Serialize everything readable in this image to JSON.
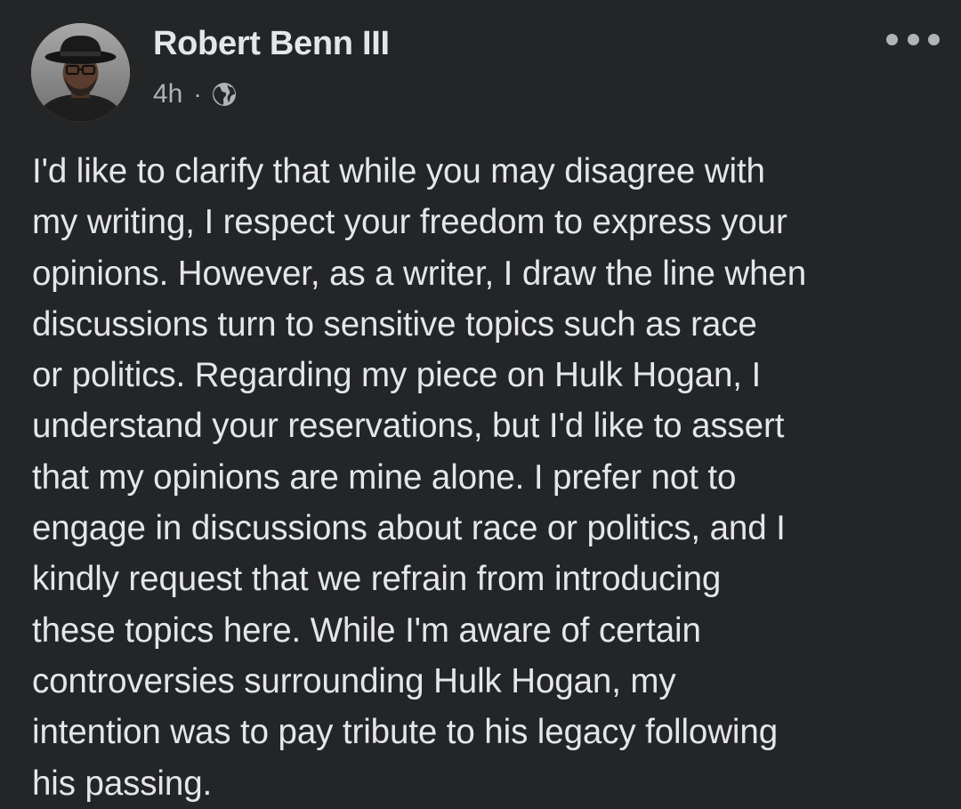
{
  "post": {
    "author": {
      "name": "Robert Benn III"
    },
    "meta": {
      "time": "4h",
      "separator": "·",
      "audience_icon": "globe-icon"
    },
    "menu_icon": "more-options-icon",
    "body": {
      "lines": [
        "I'd like to clarify that while you may disagree with",
        "my writing, I respect your freedom to express your",
        "opinions. However, as a writer, I draw the line when",
        "discussions turn to sensitive topics such as race",
        "or politics. Regarding my piece on Hulk Hogan, I",
        "understand your reservations, but I'd like to assert",
        "that my opinions are mine alone. I prefer not to",
        "engage in discussions about race or politics, and I",
        "kindly request that we refrain from introducing",
        "these topics here. While I'm aware of certain",
        "controversies surrounding Hulk Hogan, my",
        "intention was to pay tribute to his legacy following",
        "his passing."
      ]
    }
  },
  "colors": {
    "background": "#242526",
    "primary_text": "#e4e6eb",
    "secondary_text": "#b0b3b8"
  }
}
